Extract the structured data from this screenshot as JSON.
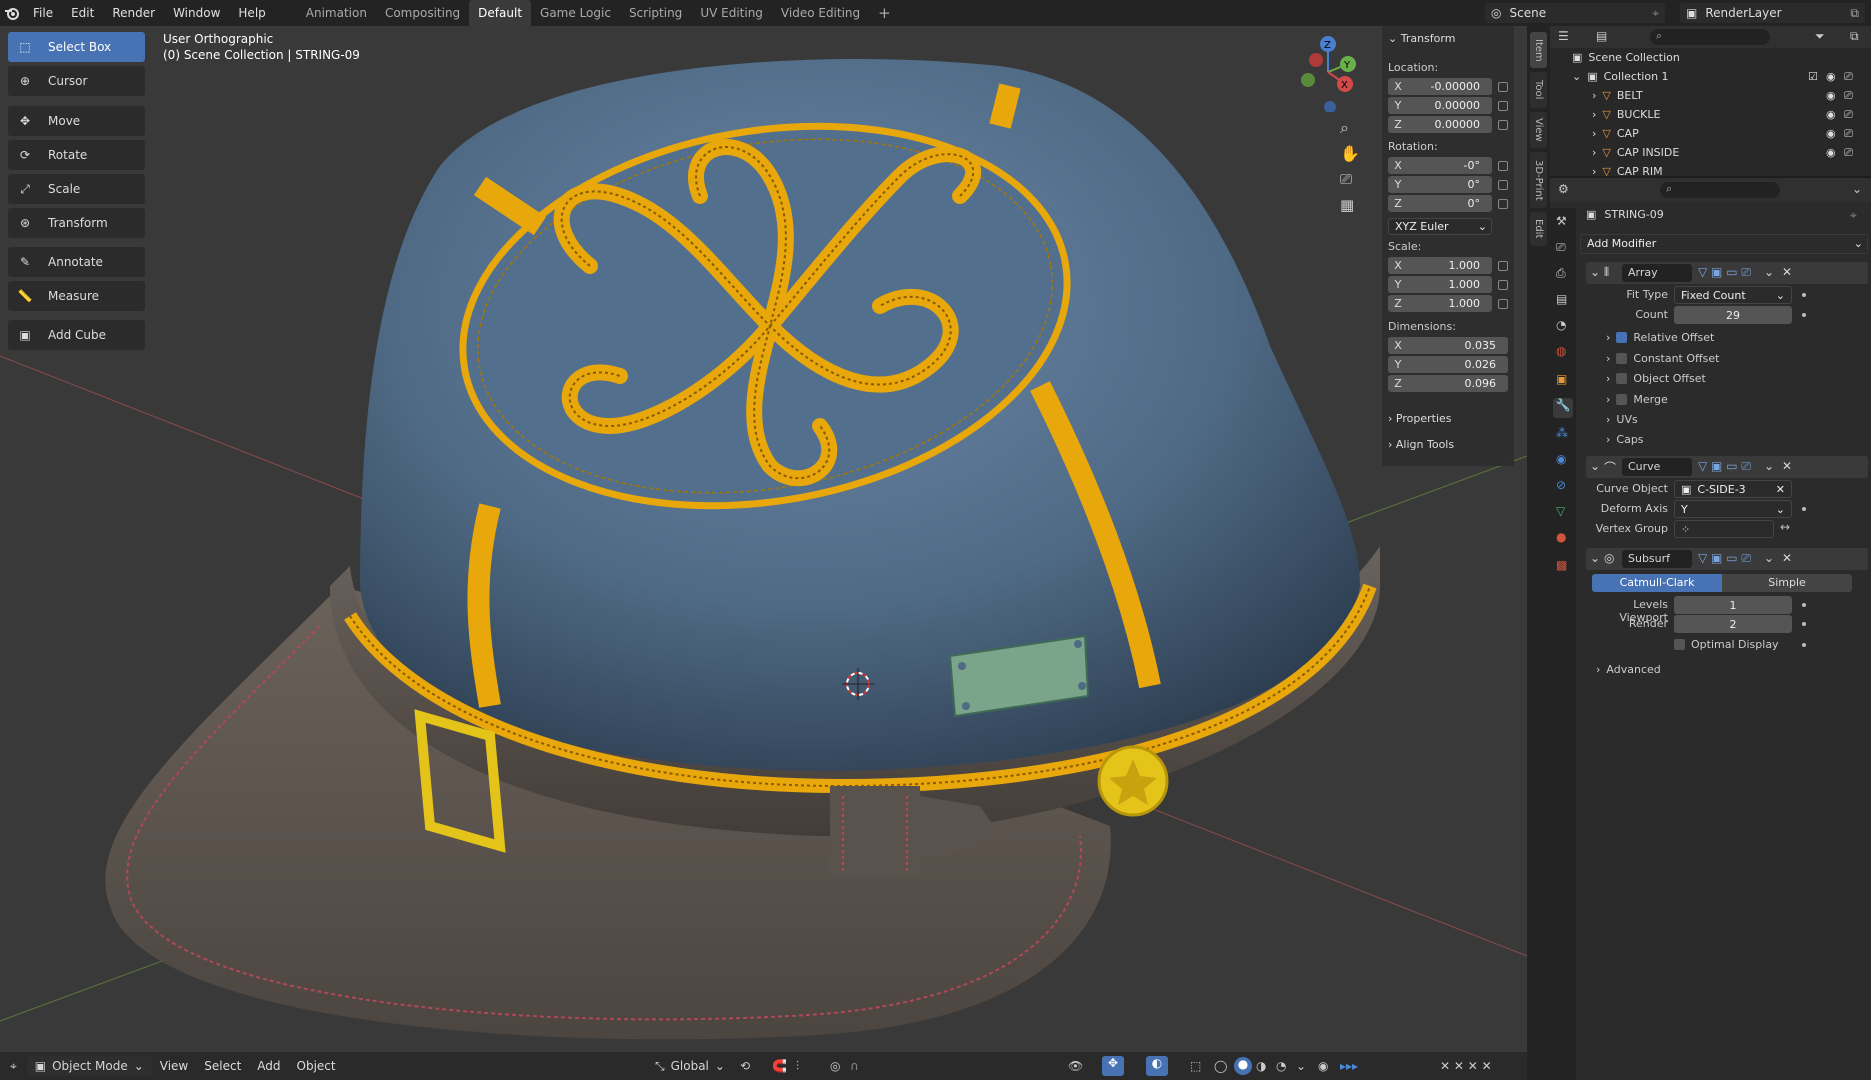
{
  "menu": [
    "File",
    "Edit",
    "Render",
    "Window",
    "Help"
  ],
  "workspaces": [
    "Animation",
    "Compositing",
    "Default",
    "Game Logic",
    "Scripting",
    "UV Editing",
    "Video Editing"
  ],
  "active_workspace": "Default",
  "scene_name": "Scene",
  "render_layer": "RenderLayer",
  "viewport": {
    "view_name": "User Orthographic",
    "collection_info": "(0) Scene Collection | STRING-09"
  },
  "tools": [
    "Select Box",
    "Cursor",
    "Move",
    "Rotate",
    "Scale",
    "Transform",
    "Annotate",
    "Measure",
    "Add Cube"
  ],
  "transform": {
    "header": "Transform",
    "location_label": "Location:",
    "location": [
      {
        "axis": "X",
        "value": "-0.00000"
      },
      {
        "axis": "Y",
        "value": "0.00000"
      },
      {
        "axis": "Z",
        "value": "0.00000"
      }
    ],
    "rotation_label": "Rotation:",
    "rotation": [
      {
        "axis": "X",
        "value": "-0°"
      },
      {
        "axis": "Y",
        "value": "0°"
      },
      {
        "axis": "Z",
        "value": "0°"
      }
    ],
    "rotation_mode": "XYZ Euler",
    "scale_label": "Scale:",
    "scale": [
      {
        "axis": "X",
        "value": "1.000"
      },
      {
        "axis": "Y",
        "value": "1.000"
      },
      {
        "axis": "Z",
        "value": "1.000"
      }
    ],
    "dimensions_label": "Dimensions:",
    "dimensions": [
      {
        "axis": "X",
        "value": "0.035"
      },
      {
        "axis": "Y",
        "value": "0.026"
      },
      {
        "axis": "Z",
        "value": "0.096"
      }
    ],
    "properties": "Properties",
    "align_tools": "Align Tools"
  },
  "side_tabs": [
    "Item",
    "Tool",
    "View",
    "3D-Print",
    "Edit"
  ],
  "outliner": {
    "root": "Scene Collection",
    "collection": "Collection 1",
    "items": [
      "BELT",
      "BUCKLE",
      "CAP",
      "CAP INSIDE",
      "CAP RIM"
    ]
  },
  "properties": {
    "object_name": "STRING-09",
    "add_modifier": "Add Modifier",
    "array": {
      "name": "Array",
      "fit_type_label": "Fit Type",
      "fit_type": "Fixed Count",
      "count_label": "Count",
      "count": "29",
      "relative_offset": "Relative Offset",
      "constant_offset": "Constant Offset",
      "object_offset": "Object Offset",
      "merge": "Merge",
      "uvs": "UVs",
      "caps": "Caps"
    },
    "curve": {
      "name": "Curve",
      "curve_object_label": "Curve Object",
      "curve_object": "C-SIDE-3",
      "deform_axis_label": "Deform Axis",
      "deform_axis": "Y",
      "vertex_group_label": "Vertex Group"
    },
    "subsurf": {
      "name": "Subsurf",
      "catmull": "Catmull-Clark",
      "simple": "Simple",
      "levels_viewport_label": "Levels Viewport",
      "levels_viewport": "1",
      "render_label": "Render",
      "render": "2",
      "optimal_display": "Optimal Display",
      "advanced": "Advanced"
    }
  },
  "bottom_bar": {
    "mode": "Object Mode",
    "menus": [
      "View",
      "Select",
      "Add",
      "Object"
    ],
    "orientation": "Global"
  },
  "colors": {
    "accent": "#4772b3",
    "cap_blue": "#4f6a85",
    "gold": "#e8a70a",
    "leather": "#5a524c"
  }
}
